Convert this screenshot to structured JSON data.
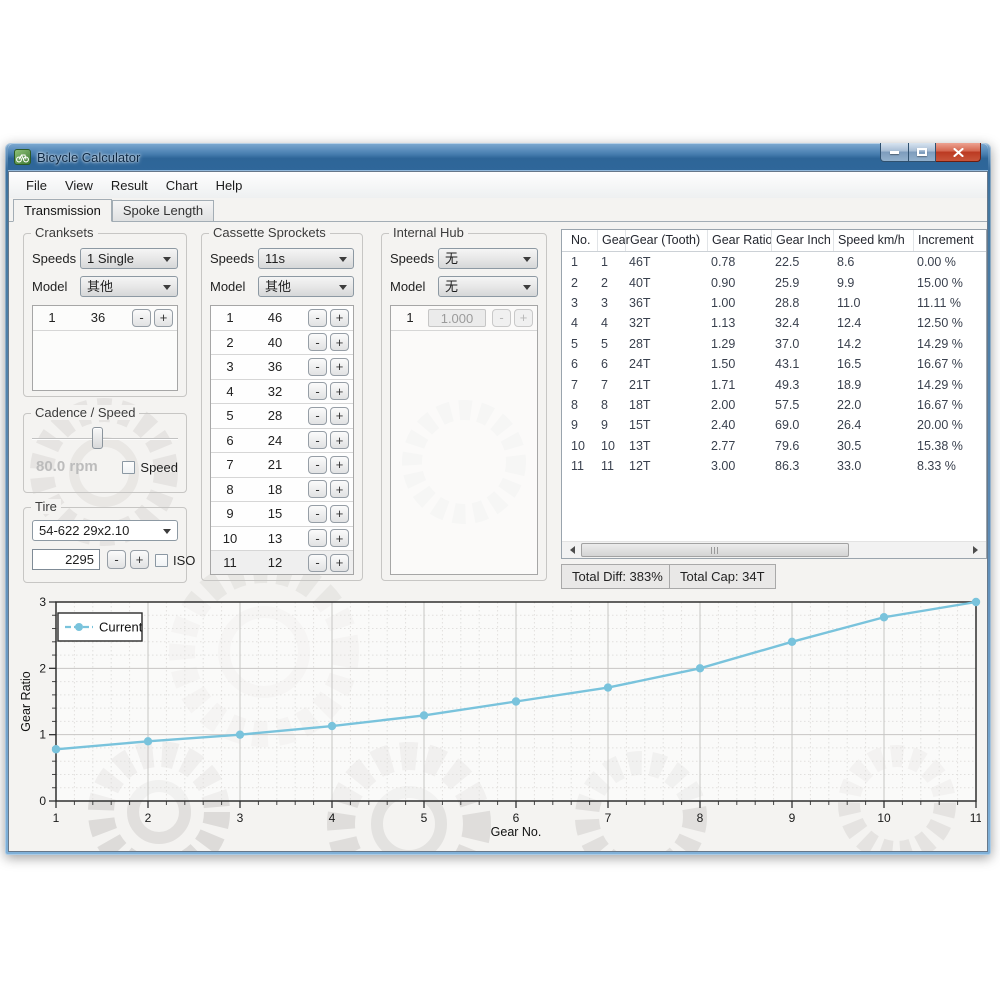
{
  "window": {
    "title": "Bicycle Calculator"
  },
  "menu": {
    "items": [
      "File",
      "View",
      "Result",
      "Chart",
      "Help"
    ]
  },
  "tabs": {
    "transmission": "Transmission",
    "spoke_length": "Spoke Length"
  },
  "controls": {
    "minus_label": "-",
    "plus_label": "+"
  },
  "cranksets": {
    "title": "Cranksets",
    "speeds_label": "Speeds",
    "speeds_value": "1 Single",
    "model_label": "Model",
    "model_value": "其他",
    "rows": [
      {
        "no": "1",
        "value": "36"
      }
    ]
  },
  "cassette": {
    "title": "Cassette Sprockets",
    "speeds_label": "Speeds",
    "speeds_value": "11s",
    "model_label": "Model",
    "model_value": "其他",
    "rows": [
      {
        "no": "1",
        "value": "46"
      },
      {
        "no": "2",
        "value": "40"
      },
      {
        "no": "3",
        "value": "36"
      },
      {
        "no": "4",
        "value": "32"
      },
      {
        "no": "5",
        "value": "28"
      },
      {
        "no": "6",
        "value": "24"
      },
      {
        "no": "7",
        "value": "21"
      },
      {
        "no": "8",
        "value": "18"
      },
      {
        "no": "9",
        "value": "15"
      },
      {
        "no": "10",
        "value": "13"
      },
      {
        "no": "11",
        "value": "12"
      }
    ]
  },
  "hub": {
    "title": "Internal Hub",
    "speeds_label": "Speeds",
    "speeds_value": "无",
    "model_label": "Model",
    "model_value": "无",
    "rows": [
      {
        "no": "1",
        "value": "1.000",
        "disabled": true
      }
    ]
  },
  "cadence": {
    "title": "Cadence / Speed",
    "rpm_value": "80.0 rpm",
    "speed_label": "Speed",
    "slider_percent": 42
  },
  "tire": {
    "title": "Tire",
    "size_value": "54-622 29x2.10",
    "circumference": "2295",
    "iso_label": "ISO"
  },
  "results": {
    "columns": [
      "No.",
      "Gear",
      "Gear (Tooth)",
      "Gear Ratio",
      "Gear Inch",
      "Speed km/h",
      "Increment"
    ],
    "rows": [
      [
        "1",
        "1",
        "46T",
        "0.78",
        "22.5",
        "8.6",
        "0.00 %"
      ],
      [
        "2",
        "2",
        "40T",
        "0.90",
        "25.9",
        "9.9",
        "15.00 %"
      ],
      [
        "3",
        "3",
        "36T",
        "1.00",
        "28.8",
        "11.0",
        "11.11 %"
      ],
      [
        "4",
        "4",
        "32T",
        "1.13",
        "32.4",
        "12.4",
        "12.50 %"
      ],
      [
        "5",
        "5",
        "28T",
        "1.29",
        "37.0",
        "14.2",
        "14.29 %"
      ],
      [
        "6",
        "6",
        "24T",
        "1.50",
        "43.1",
        "16.5",
        "16.67 %"
      ],
      [
        "7",
        "7",
        "21T",
        "1.71",
        "49.3",
        "18.9",
        "14.29 %"
      ],
      [
        "8",
        "8",
        "18T",
        "2.00",
        "57.5",
        "22.0",
        "16.67 %"
      ],
      [
        "9",
        "9",
        "15T",
        "2.40",
        "69.0",
        "26.4",
        "20.00 %"
      ],
      [
        "10",
        "10",
        "13T",
        "2.77",
        "79.6",
        "30.5",
        "15.38 %"
      ],
      [
        "11",
        "11",
        "12T",
        "3.00",
        "86.3",
        "33.0",
        "8.33 %"
      ]
    ],
    "total_diff": "Total Diff: 383%",
    "total_cap": "Total Cap: 34T"
  },
  "chart_data": {
    "type": "line",
    "xlabel": "Gear No.",
    "ylabel": "Gear Ratio",
    "x": [
      1,
      2,
      3,
      4,
      5,
      6,
      7,
      8,
      9,
      10,
      11
    ],
    "series": [
      {
        "name": "Current",
        "color": "#79c3dc",
        "values": [
          0.78,
          0.9,
          1.0,
          1.13,
          1.29,
          1.5,
          1.71,
          2.0,
          2.4,
          2.77,
          3.0
        ]
      }
    ],
    "xlim": [
      1,
      11
    ],
    "ylim": [
      0,
      3
    ],
    "xticks": [
      1,
      2,
      3,
      4,
      5,
      6,
      7,
      8,
      9,
      10,
      11
    ],
    "yticks": [
      0,
      1,
      2,
      3
    ],
    "minor_step": 0.2,
    "grid": true,
    "legend_position": "top-left"
  }
}
